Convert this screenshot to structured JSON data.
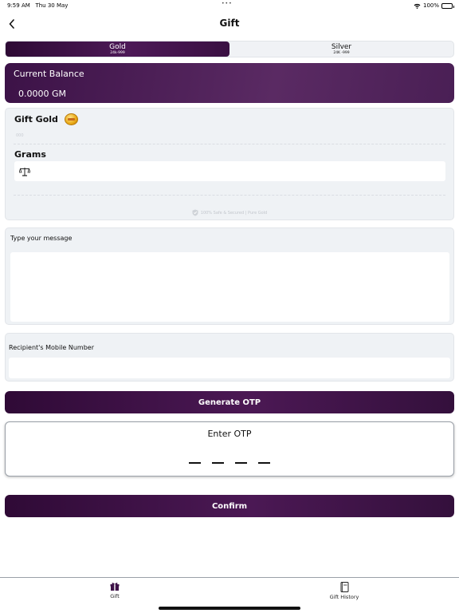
{
  "status": {
    "time": "9:59 AM",
    "date": "Thu 30 May",
    "dots": "•••",
    "battery": "100%"
  },
  "header": {
    "title": "Gift"
  },
  "metal_tabs": [
    {
      "label": "Gold",
      "sub": "24k-999",
      "active": true
    },
    {
      "label": "Silver",
      "sub": "24K -999",
      "active": false
    }
  ],
  "balance": {
    "title": "Current Balance",
    "value": "0.0000 GM"
  },
  "gift_gold": {
    "title": "Gift Gold",
    "faint_value": "000",
    "grams_label": "Grams",
    "purity_note": "100% Safe & Secured | Pure Gold"
  },
  "message": {
    "label": "Type your message",
    "value": ""
  },
  "recipient": {
    "label": "Recipient's Mobile Number",
    "value": ""
  },
  "buttons": {
    "generate_otp": "Generate OTP",
    "confirm": "Confirm"
  },
  "otp": {
    "title": "Enter OTP"
  },
  "tabbar": {
    "gift": "Gift",
    "history": "Gift History"
  },
  "colors": {
    "brand": "#3e1248",
    "panel": "#eff2f5",
    "coin": "#e8a814"
  },
  "icons": [
    "back-chevron-icon",
    "gold-coin-icon",
    "balance-scale-icon",
    "shield-icon",
    "gift-icon",
    "gift-history-icon",
    "wifi-icon",
    "battery-icon"
  ]
}
